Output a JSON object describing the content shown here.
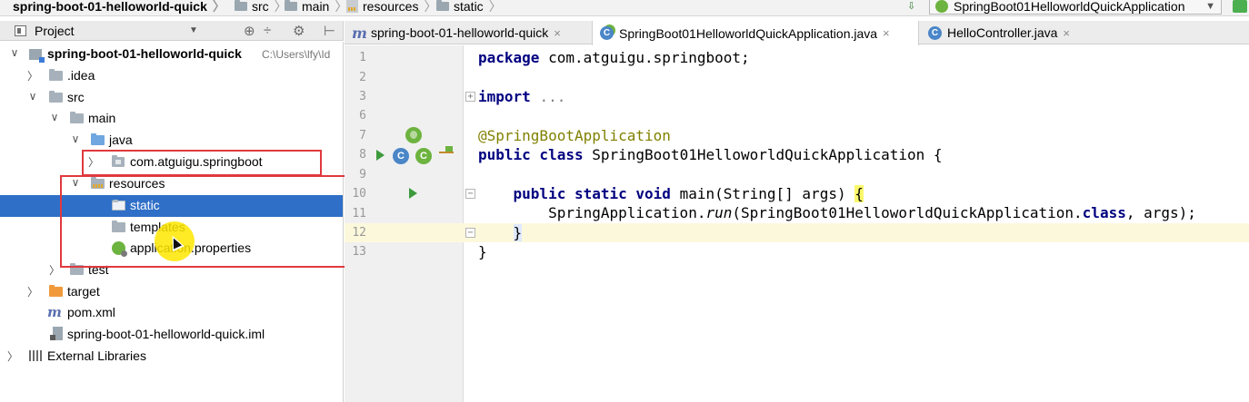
{
  "breadcrumb": {
    "project": "spring-boot-01-helloworld-quick",
    "items": [
      "src",
      "main",
      "resources",
      "static"
    ]
  },
  "run_config": {
    "name": "SpringBoot01HelloworldQuickApplication"
  },
  "project_panel": {
    "title": "Project"
  },
  "tree": {
    "root": {
      "label": "spring-boot-01-helloworld-quick",
      "path": "C:\\Users\\lfy\\Id"
    },
    "idea": ".idea",
    "src": "src",
    "main": "main",
    "java": "java",
    "pkg": "com.atguigu.springboot",
    "resources": "resources",
    "static": "static",
    "templates": "templates",
    "props": "application.properties",
    "test": "test",
    "target": "target",
    "pom": "pom.xml",
    "iml": "spring-boot-01-helloworld-quick.iml",
    "libs": "External Libraries"
  },
  "tabs": [
    {
      "label": "spring-boot-01-helloworld-quick",
      "close": "×"
    },
    {
      "label": "SpringBoot01HelloworldQuickApplication.java",
      "close": "×"
    },
    {
      "label": "HelloController.java",
      "close": "×"
    }
  ],
  "editor": {
    "line_numbers": [
      "1",
      "2",
      "3",
      "6",
      "7",
      "8",
      "9",
      "10",
      "11",
      "12",
      "13"
    ],
    "code": {
      "package_kw": "package",
      "package_name": "com.atguigu.springboot;",
      "import_kw": "import",
      "import_fold": "...",
      "annotation": "@SpringBootApplication",
      "class_mods": "public class",
      "class_name": "SpringBoot01HelloworldQuickApplication {",
      "method_mods": "public static void",
      "method_sig": "main(String[] args)",
      "open_brace": "{",
      "call_prefix": "SpringApplication.",
      "call_method": "run",
      "call_args_a": "(SpringBoot01HelloworldQuickApplication.",
      "class_kw": "class",
      "call_args_b": ", args);",
      "close_method": "}",
      "close_class": "}"
    }
  },
  "colors": {
    "selection": "#2f6fc7",
    "highlight_box": "#e0393e",
    "keyword": "#000080",
    "annotation": "#808000",
    "current_line": "#fcf8dc"
  }
}
